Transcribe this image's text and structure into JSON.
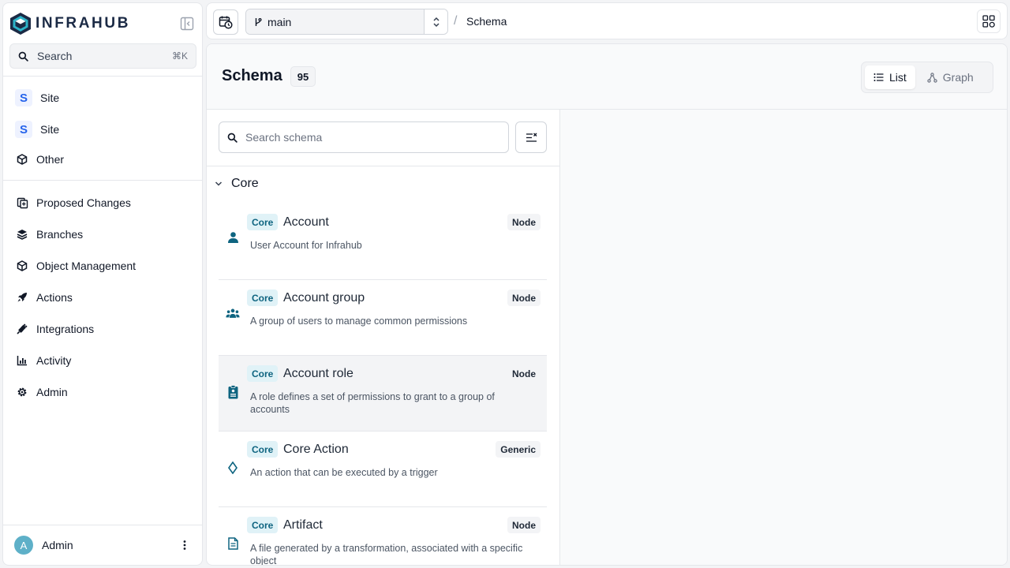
{
  "app": {
    "logo_text": "INFRAHUB",
    "accent_color": "#0e6480"
  },
  "sidebar": {
    "search_label": "Search",
    "search_shortcut": "⌘K",
    "sites": [
      {
        "badge": "S",
        "label": "Site"
      },
      {
        "badge": "S",
        "label": "Site"
      }
    ],
    "other_label": "Other",
    "items": [
      {
        "label": "Proposed Changes",
        "icon": "proposed-changes-icon"
      },
      {
        "label": "Branches",
        "icon": "branches-icon"
      },
      {
        "label": "Object Management",
        "icon": "cube-icon"
      },
      {
        "label": "Actions",
        "icon": "rocket-icon"
      },
      {
        "label": "Integrations",
        "icon": "plug-icon"
      },
      {
        "label": "Activity",
        "icon": "activity-icon"
      },
      {
        "label": "Admin",
        "icon": "gear-icon"
      }
    ],
    "user": {
      "initial": "A",
      "name": "Admin"
    }
  },
  "topbar": {
    "branch": "main",
    "breadcrumb_sep": "/",
    "breadcrumb": "Schema"
  },
  "page": {
    "title": "Schema",
    "count": "95",
    "views": [
      {
        "label": "List",
        "active": true
      },
      {
        "label": "Graph",
        "active": false
      }
    ]
  },
  "schema_list": {
    "search_placeholder": "Search schema",
    "group": "Core",
    "items": [
      {
        "namespace": "Core",
        "name": "Account",
        "kind": "Node",
        "description": "User Account for Infrahub",
        "icon": "user-icon"
      },
      {
        "namespace": "Core",
        "name": "Account group",
        "kind": "Node",
        "description": "A group of users to manage common permissions",
        "icon": "users-group-icon"
      },
      {
        "namespace": "Core",
        "name": "Account role",
        "kind": "Node",
        "description": "A role defines a set of permissions to grant to a group of accounts",
        "icon": "badge-icon"
      },
      {
        "namespace": "Core",
        "name": "Core Action",
        "kind": "Generic",
        "description": "An action that can be executed by a trigger",
        "icon": "diamond-icon"
      },
      {
        "namespace": "Core",
        "name": "Artifact",
        "kind": "Node",
        "description": "A file generated by a transformation, associated with a specific object",
        "icon": "file-icon"
      }
    ]
  }
}
